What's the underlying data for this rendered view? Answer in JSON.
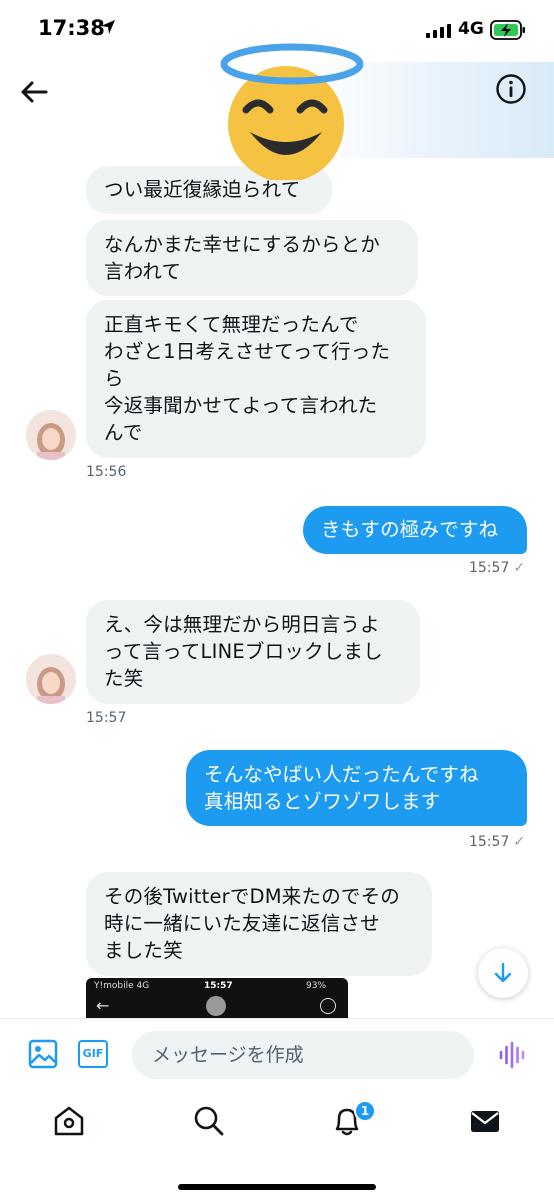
{
  "status_bar": {
    "time": "17:38",
    "network": "4G"
  },
  "header": {
    "back_icon": "arrow-left-icon",
    "info_icon": "info-circle-icon",
    "sticker": "smiling-face-with-halo-sticker"
  },
  "messages": [
    {
      "side": "in",
      "text": "つい最近復縁迫られて"
    },
    {
      "side": "in",
      "text": "なんかまた幸せにするからとか\n言われて"
    },
    {
      "side": "in",
      "text": "正直キモくて無理だったんで\nわざと1日考えさせてって行った\nら\n今返事聞かせてよって言われた\nんで",
      "time": "15:56"
    },
    {
      "side": "out",
      "text": "きもすの極みですね",
      "time": "15:57",
      "status": "✓"
    },
    {
      "side": "in",
      "text": "え、今は無理だから明日言うよ\nって言ってLINEブロックしまし\nた笑",
      "time": "15:57"
    },
    {
      "side": "out",
      "text": "そんなやばい人だったんですね\n真相知るとゾワゾワします",
      "time": "15:57",
      "status": "✓"
    },
    {
      "side": "in",
      "text": "その後TwitterでDM来たのでその\n時に一緒にいた友達に返信させ\nました笑"
    }
  ],
  "attachment": {
    "carrier": "Y!mobile  4G",
    "time": "15:57",
    "battery": "93%"
  },
  "composer": {
    "placeholder": "メッセージを作成",
    "gif_label": "GIF",
    "image_icon": "image-icon",
    "voice_icon": "voice-wave-icon"
  },
  "scroll_icon": "arrow-down-icon",
  "bottom_nav": {
    "notifications_badge": "1",
    "items": [
      "home-icon",
      "search-icon",
      "bell-icon",
      "mail-icon"
    ]
  },
  "colors": {
    "accent": "#1d9bf0",
    "incoming_bubble": "#eff3f4",
    "text": "#0f1419",
    "muted": "#536471"
  }
}
